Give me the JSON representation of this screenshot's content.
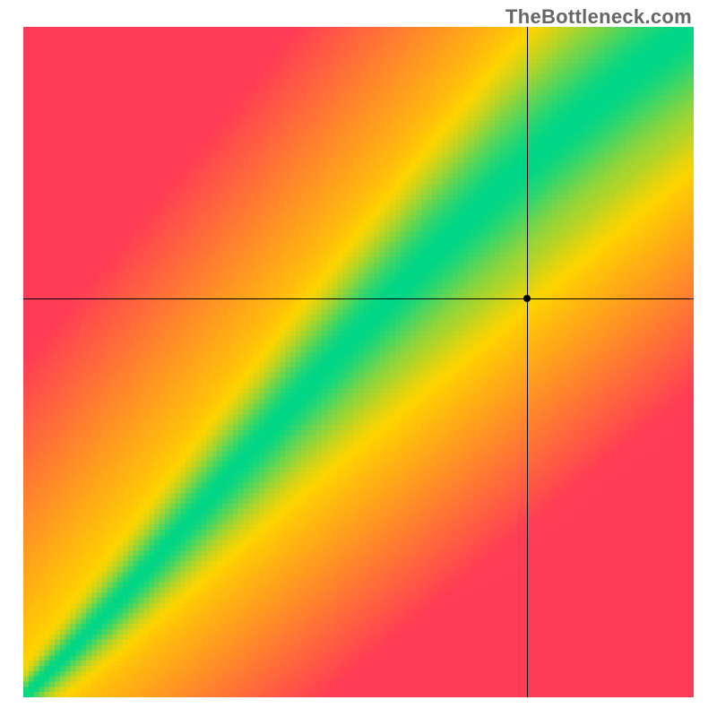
{
  "watermark": "TheBottleneck.com",
  "chart_data": {
    "type": "heatmap",
    "title": "",
    "xlabel": "",
    "ylabel": "",
    "xlim": [
      0,
      1
    ],
    "ylim": [
      0,
      1
    ],
    "grid": false,
    "legend_position": "none",
    "resolution": 128,
    "colors": {
      "low": "#ff3b56",
      "mid": "#ffd400",
      "high": "#00d787"
    },
    "crosshair": {
      "x": 0.752,
      "y": 0.595
    },
    "annotations": []
  }
}
